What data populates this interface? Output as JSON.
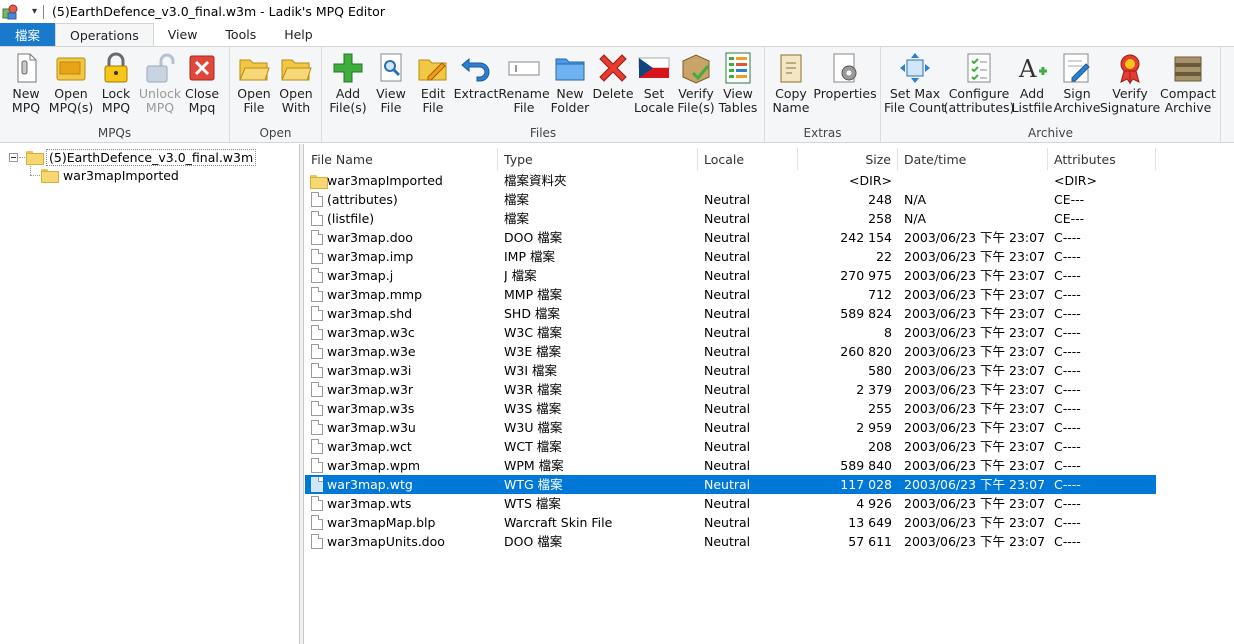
{
  "window": {
    "title": "(5)EarthDefence_v3.0_final.w3m - Ladik's MPQ Editor",
    "quick_access": "▾"
  },
  "tabs": [
    {
      "label": "檔案"
    },
    {
      "label": "Operations"
    },
    {
      "label": "View"
    },
    {
      "label": "Tools"
    },
    {
      "label": "Help"
    }
  ],
  "ribbon": {
    "groups": {
      "mpqs": "MPQs",
      "open": "Open",
      "files": "Files",
      "extras": "Extras",
      "archive": "Archive"
    },
    "buttons": {
      "new_mpq": "New\nMPQ",
      "open_mpq": "Open\nMPQ(s)",
      "lock_mpq": "Lock\nMPQ",
      "unlock_mpq": "Unlock\nMPQ",
      "close_mpq": "Close\nMpq",
      "open_file": "Open\nFile",
      "open_with": "Open\nWith",
      "add_files": "Add\nFile(s)",
      "view_file": "View\nFile",
      "edit_file": "Edit\nFile",
      "extract": "Extract",
      "rename_file": "Rename\nFile",
      "new_folder": "New\nFolder",
      "delete": "Delete",
      "set_locale": "Set\nLocale",
      "verify_files": "Verify\nFile(s)",
      "view_tables": "View\nTables",
      "copy_name": "Copy\nName",
      "properties": "Properties",
      "set_max_file_count": "Set Max\nFile Count",
      "configure_attributes": "Configure\n(attributes)",
      "add_listfile": "Add\nListfile",
      "sign_archive": "Sign\nArchive",
      "verify_signature": "Verify\nSignature",
      "compact_archive": "Compact\nArchive"
    }
  },
  "tree": {
    "root": "(5)EarthDefence_v3.0_final.w3m",
    "children": [
      "war3mapImported"
    ]
  },
  "columns": {
    "name": "File Name",
    "type": "Type",
    "locale": "Locale",
    "size": "Size",
    "datetime": "Date/time",
    "attributes": "Attributes"
  },
  "rows": [
    {
      "name": "war3mapImported",
      "type": "檔案資料夾",
      "locale": "",
      "size": "<DIR>",
      "datetime": "",
      "attributes": "<DIR>",
      "folder": true
    },
    {
      "name": "(attributes)",
      "type": "檔案",
      "locale": "Neutral",
      "size": "248",
      "datetime": "N/A",
      "attributes": "CE---"
    },
    {
      "name": "(listfile)",
      "type": "檔案",
      "locale": "Neutral",
      "size": "258",
      "datetime": "N/A",
      "attributes": "CE---"
    },
    {
      "name": "war3map.doo",
      "type": "DOO 檔案",
      "locale": "Neutral",
      "size": "242 154",
      "datetime": "2003/06/23 下午 23:07",
      "attributes": "C----"
    },
    {
      "name": "war3map.imp",
      "type": "IMP 檔案",
      "locale": "Neutral",
      "size": "22",
      "datetime": "2003/06/23 下午 23:07",
      "attributes": "C----"
    },
    {
      "name": "war3map.j",
      "type": "J 檔案",
      "locale": "Neutral",
      "size": "270 975",
      "datetime": "2003/06/23 下午 23:07",
      "attributes": "C----"
    },
    {
      "name": "war3map.mmp",
      "type": "MMP 檔案",
      "locale": "Neutral",
      "size": "712",
      "datetime": "2003/06/23 下午 23:07",
      "attributes": "C----"
    },
    {
      "name": "war3map.shd",
      "type": "SHD 檔案",
      "locale": "Neutral",
      "size": "589 824",
      "datetime": "2003/06/23 下午 23:07",
      "attributes": "C----"
    },
    {
      "name": "war3map.w3c",
      "type": "W3C 檔案",
      "locale": "Neutral",
      "size": "8",
      "datetime": "2003/06/23 下午 23:07",
      "attributes": "C----"
    },
    {
      "name": "war3map.w3e",
      "type": "W3E 檔案",
      "locale": "Neutral",
      "size": "260 820",
      "datetime": "2003/06/23 下午 23:07",
      "attributes": "C----"
    },
    {
      "name": "war3map.w3i",
      "type": "W3I 檔案",
      "locale": "Neutral",
      "size": "580",
      "datetime": "2003/06/23 下午 23:07",
      "attributes": "C----"
    },
    {
      "name": "war3map.w3r",
      "type": "W3R 檔案",
      "locale": "Neutral",
      "size": "2 379",
      "datetime": "2003/06/23 下午 23:07",
      "attributes": "C----"
    },
    {
      "name": "war3map.w3s",
      "type": "W3S 檔案",
      "locale": "Neutral",
      "size": "255",
      "datetime": "2003/06/23 下午 23:07",
      "attributes": "C----"
    },
    {
      "name": "war3map.w3u",
      "type": "W3U 檔案",
      "locale": "Neutral",
      "size": "2 959",
      "datetime": "2003/06/23 下午 23:07",
      "attributes": "C----"
    },
    {
      "name": "war3map.wct",
      "type": "WCT 檔案",
      "locale": "Neutral",
      "size": "208",
      "datetime": "2003/06/23 下午 23:07",
      "attributes": "C----"
    },
    {
      "name": "war3map.wpm",
      "type": "WPM 檔案",
      "locale": "Neutral",
      "size": "589 840",
      "datetime": "2003/06/23 下午 23:07",
      "attributes": "C----"
    },
    {
      "name": "war3map.wtg",
      "type": "WTG 檔案",
      "locale": "Neutral",
      "size": "117 028",
      "datetime": "2003/06/23 下午 23:07",
      "attributes": "C----",
      "selected": true
    },
    {
      "name": "war3map.wts",
      "type": "WTS 檔案",
      "locale": "Neutral",
      "size": "4 926",
      "datetime": "2003/06/23 下午 23:07",
      "attributes": "C----"
    },
    {
      "name": "war3mapMap.blp",
      "type": "Warcraft Skin File",
      "locale": "Neutral",
      "size": "13 649",
      "datetime": "2003/06/23 下午 23:07",
      "attributes": "C----"
    },
    {
      "name": "war3mapUnits.doo",
      "type": "DOO 檔案",
      "locale": "Neutral",
      "size": "57 611",
      "datetime": "2003/06/23 下午 23:07",
      "attributes": "C----"
    }
  ]
}
